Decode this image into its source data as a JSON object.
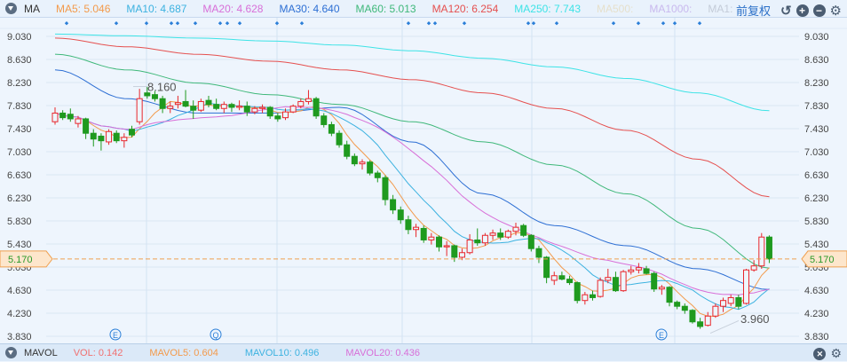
{
  "header": {
    "title": "MA",
    "ma": [
      {
        "label": "MA5: 5.046",
        "color": "#f39a4b"
      },
      {
        "label": "MA10: 4.687",
        "color": "#3cb2e0"
      },
      {
        "label": "MA20: 4.628",
        "color": "#d86fd8"
      },
      {
        "label": "MA30: 4.640",
        "color": "#2d6fd4"
      },
      {
        "label": "MA60: 5.013",
        "color": "#3fb87a"
      },
      {
        "label": "MA120: 6.254",
        "color": "#e5504f"
      },
      {
        "label": "MA250: 7.743",
        "color": "#3de3e6"
      },
      {
        "label": "MA500:",
        "color": "#e6e0cc"
      },
      {
        "label": "MA1000:",
        "color": "#c9b9ee"
      },
      {
        "label": "MA1:",
        "color": "#c4ccd8"
      }
    ],
    "adjust": "前复权"
  },
  "footer": {
    "title": "MAVOL",
    "items": [
      {
        "label": "VOL: 0.142",
        "color": "#f07070"
      },
      {
        "label": "MAVOL5: 0.604",
        "color": "#f39a4b"
      },
      {
        "label": "MAVOL10: 0.496",
        "color": "#3cb2e0"
      },
      {
        "label": "MAVOL20: 0.436",
        "color": "#d86fd8"
      }
    ]
  },
  "chart_data": {
    "type": "candlestick",
    "yticks": [
      "9.030",
      "8.630",
      "8.230",
      "7.830",
      "7.430",
      "7.030",
      "6.630",
      "6.230",
      "5.830",
      "5.430",
      "5.030",
      "4.630",
      "4.230",
      "3.830"
    ],
    "ylim": [
      3.83,
      9.03
    ],
    "current_price": "5.170",
    "high_label": "8.160",
    "low_label": "3.960",
    "event_markers": [
      "E",
      "Q",
      "E"
    ],
    "up_color": "#e8262b",
    "down_color": "#1f9a1f",
    "candles": [
      [
        7.55,
        7.8,
        7.5,
        7.7
      ],
      [
        7.7,
        7.75,
        7.58,
        7.62
      ],
      [
        7.68,
        7.78,
        7.55,
        7.6
      ],
      [
        7.52,
        7.65,
        7.45,
        7.6
      ],
      [
        7.6,
        7.62,
        7.25,
        7.35
      ],
      [
        7.35,
        7.42,
        7.12,
        7.25
      ],
      [
        7.3,
        7.35,
        7.05,
        7.22
      ],
      [
        7.2,
        7.42,
        7.15,
        7.38
      ],
      [
        7.35,
        7.4,
        7.18,
        7.22
      ],
      [
        7.22,
        7.35,
        7.1,
        7.28
      ],
      [
        7.42,
        7.48,
        7.28,
        7.32
      ],
      [
        7.55,
        8.12,
        7.5,
        7.95
      ],
      [
        8.05,
        8.16,
        7.95,
        8.0
      ],
      [
        8.02,
        8.08,
        7.9,
        7.95
      ],
      [
        7.95,
        8.0,
        7.7,
        7.78
      ],
      [
        7.78,
        7.9,
        7.7,
        7.82
      ],
      [
        7.85,
        8.0,
        7.78,
        7.88
      ],
      [
        7.9,
        8.1,
        7.8,
        7.82
      ],
      [
        7.82,
        7.92,
        7.6,
        7.75
      ],
      [
        7.75,
        7.95,
        7.72,
        7.9
      ],
      [
        7.92,
        8.0,
        7.8,
        7.85
      ],
      [
        7.85,
        7.95,
        7.75,
        7.78
      ],
      [
        7.78,
        7.9,
        7.7,
        7.85
      ],
      [
        7.85,
        7.88,
        7.72,
        7.8
      ],
      [
        7.8,
        7.92,
        7.75,
        7.82
      ],
      [
        7.82,
        7.9,
        7.65,
        7.72
      ],
      [
        7.72,
        7.82,
        7.68,
        7.78
      ],
      [
        7.78,
        7.85,
        7.7,
        7.8
      ],
      [
        7.8,
        7.82,
        7.6,
        7.65
      ],
      [
        7.65,
        7.7,
        7.55,
        7.6
      ],
      [
        7.62,
        7.78,
        7.58,
        7.72
      ],
      [
        7.72,
        7.85,
        7.7,
        7.82
      ],
      [
        7.82,
        7.95,
        7.78,
        7.9
      ],
      [
        7.9,
        8.1,
        7.85,
        7.95
      ],
      [
        7.95,
        7.98,
        7.6,
        7.65
      ],
      [
        7.65,
        7.7,
        7.45,
        7.5
      ],
      [
        7.5,
        7.55,
        7.3,
        7.35
      ],
      [
        7.35,
        7.4,
        7.1,
        7.15
      ],
      [
        7.15,
        7.22,
        6.9,
        6.95
      ],
      [
        6.95,
        7.0,
        6.78,
        6.82
      ],
      [
        6.82,
        6.9,
        6.72,
        6.85
      ],
      [
        6.85,
        6.88,
        6.62,
        6.66
      ],
      [
        6.66,
        6.7,
        6.5,
        6.58
      ],
      [
        6.58,
        6.62,
        6.1,
        6.2
      ],
      [
        6.2,
        6.28,
        5.95,
        6.02
      ],
      [
        6.02,
        6.08,
        5.78,
        5.85
      ],
      [
        5.85,
        5.92,
        5.6,
        5.68
      ],
      [
        5.68,
        5.78,
        5.55,
        5.72
      ],
      [
        5.7,
        5.75,
        5.45,
        5.5
      ],
      [
        5.5,
        5.62,
        5.42,
        5.55
      ],
      [
        5.55,
        5.58,
        5.3,
        5.38
      ],
      [
        5.38,
        5.48,
        5.22,
        5.4
      ],
      [
        5.4,
        5.42,
        5.12,
        5.2
      ],
      [
        5.2,
        5.35,
        5.15,
        5.28
      ],
      [
        5.28,
        5.6,
        5.25,
        5.5
      ],
      [
        5.5,
        5.7,
        5.4,
        5.45
      ],
      [
        5.45,
        5.62,
        5.4,
        5.58
      ],
      [
        5.58,
        5.68,
        5.5,
        5.62
      ],
      [
        5.62,
        5.7,
        5.5,
        5.55
      ],
      [
        5.55,
        5.68,
        5.52,
        5.65
      ],
      [
        5.65,
        5.8,
        5.58,
        5.72
      ],
      [
        5.75,
        5.78,
        5.55,
        5.58
      ],
      [
        5.58,
        5.6,
        5.3,
        5.35
      ],
      [
        5.35,
        5.4,
        5.1,
        5.2
      ],
      [
        5.2,
        5.22,
        4.75,
        4.85
      ],
      [
        4.8,
        4.95,
        4.72,
        4.88
      ],
      [
        4.88,
        4.95,
        4.8,
        4.82
      ],
      [
        4.82,
        4.88,
        4.72,
        4.76
      ],
      [
        4.76,
        4.78,
        4.4,
        4.45
      ],
      [
        4.45,
        4.6,
        4.38,
        4.55
      ],
      [
        4.55,
        4.62,
        4.45,
        4.5
      ],
      [
        4.52,
        4.85,
        4.5,
        4.8
      ],
      [
        4.8,
        5.0,
        4.75,
        4.85
      ],
      [
        4.85,
        4.95,
        4.6,
        4.62
      ],
      [
        4.62,
        4.98,
        4.6,
        4.95
      ],
      [
        4.95,
        5.05,
        4.9,
        4.98
      ],
      [
        4.98,
        5.1,
        4.92,
        5.02
      ],
      [
        5.0,
        5.05,
        4.9,
        4.92
      ],
      [
        4.92,
        4.95,
        4.6,
        4.65
      ],
      [
        4.65,
        4.72,
        4.55,
        4.68
      ],
      [
        4.68,
        4.7,
        4.35,
        4.42
      ],
      [
        4.42,
        4.45,
        4.3,
        4.35
      ],
      [
        4.35,
        4.4,
        4.22,
        4.28
      ],
      [
        4.28,
        4.3,
        4.05,
        4.08
      ],
      [
        4.08,
        4.15,
        3.96,
        4.0
      ],
      [
        4.02,
        4.25,
        4.0,
        4.18
      ],
      [
        4.18,
        4.4,
        4.15,
        4.35
      ],
      [
        4.35,
        4.5,
        4.25,
        4.45
      ],
      [
        4.4,
        4.55,
        4.35,
        4.5
      ],
      [
        4.5,
        4.55,
        4.3,
        4.35
      ],
      [
        4.4,
        5.0,
        4.38,
        4.98
      ],
      [
        4.98,
        5.15,
        4.95,
        5.05
      ],
      [
        5.05,
        5.62,
        5.0,
        5.55
      ],
      [
        5.55,
        5.58,
        5.1,
        5.17
      ]
    ],
    "long_ma": [
      {
        "name": "MA250",
        "color": "#3de3e6",
        "values": [
          9.07,
          9.04,
          9.0,
          8.95,
          8.88,
          8.78,
          8.65,
          8.5,
          8.3,
          8.05,
          7.74
        ]
      },
      {
        "name": "MA120",
        "color": "#e5504f",
        "values": [
          9.0,
          8.85,
          8.72,
          8.6,
          8.45,
          8.28,
          8.05,
          7.78,
          7.4,
          6.9,
          6.25
        ]
      },
      {
        "name": "MA60",
        "color": "#3fb87a",
        "values": [
          8.72,
          8.45,
          8.22,
          8.02,
          7.85,
          7.55,
          7.2,
          6.8,
          6.3,
          5.7,
          5.01
        ]
      },
      {
        "name": "MA30",
        "color": "#2d6fd4",
        "values": [
          8.45,
          7.95,
          7.7,
          7.7,
          7.8,
          7.2,
          6.3,
          5.75,
          5.4,
          5.0,
          4.64
        ]
      }
    ],
    "short_ma": [
      {
        "name": "MA5",
        "period": 5,
        "color": "#f39a4b"
      },
      {
        "name": "MA10",
        "period": 10,
        "color": "#3cb2e0"
      },
      {
        "name": "MA20",
        "period": 20,
        "color": "#d86fd8"
      }
    ]
  }
}
